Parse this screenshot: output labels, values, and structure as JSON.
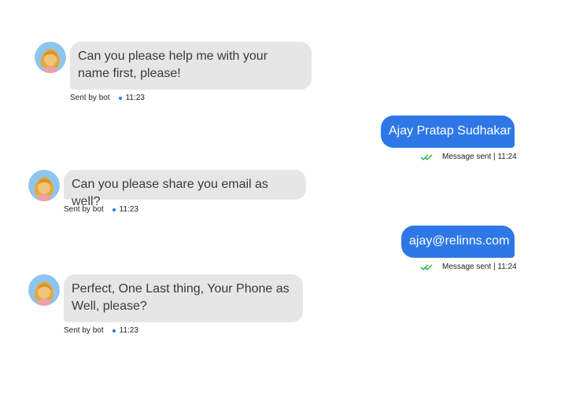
{
  "messages": [
    {
      "from": "bot",
      "text": "Can you please help me with your name first, please!",
      "sender": "Sent by bot",
      "time": "11:23"
    },
    {
      "from": "user",
      "text": "Ajay Pratap Sudhakar",
      "status": "Message sent | 11:24"
    },
    {
      "from": "bot",
      "text": "Can you please share you email as well?",
      "sender": "Sent by bot",
      "time": "11:23"
    },
    {
      "from": "user",
      "text": "ajay@relinns.com",
      "status": "Message sent | 11:24"
    },
    {
      "from": "bot",
      "text": "Perfect, One Last thing, Your Phone as Well, please?",
      "sender": "Sent by bot",
      "time": "11:23"
    }
  ],
  "colors": {
    "user_bubble": "#2d78e6",
    "bot_bubble": "#e6e6e6",
    "read_check": "#27a844",
    "meta_dot": "#2d78e6"
  },
  "icons": {
    "bot_avatar": "avatar-icon",
    "read_receipt": "double-check-icon"
  }
}
